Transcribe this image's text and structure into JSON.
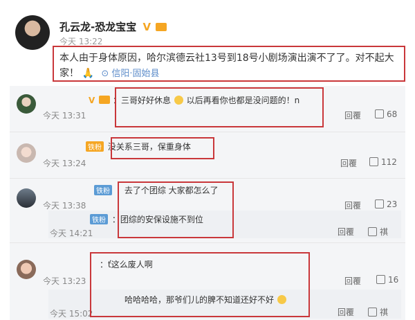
{
  "post": {
    "author": "孔云龙-恐龙宝宝",
    "verified": "V",
    "time": "今天 13:22",
    "text": "本人由于身体原因，哈尔滨德云社13号到18号小剧场演出演不了了。对不起大家！",
    "pray_emoji": "🙏",
    "location": "信阳·固始县"
  },
  "comments": [
    {
      "badge": "V",
      "text": "：三哥好好休息",
      "text_after": "以后再看你也都是没问题的！n",
      "time": "今天 13:31",
      "reply": "回覆",
      "likes": "68"
    },
    {
      "badge": "铁粉",
      "text": "没关系三哥，保重身体",
      "time": "今天 13:24",
      "reply": "回覆",
      "likes": "112"
    },
    {
      "badge": "铁粉",
      "text": "：去了个团综 大家都怎么了",
      "time": "今天 13:38",
      "reply": "回覆",
      "likes": "23",
      "sub": {
        "badge": "铁粉",
        "text": "：团综的安保设施不到位",
        "time": "今天 14:21",
        "reply": "回覆",
        "extra": "祺"
      }
    },
    {
      "text": "：ť这么废人啊",
      "time": "今天 13:23",
      "reply": "回覆",
      "likes": "16",
      "sub": {
        "text": "哈哈哈哈，那爷们儿的脾不知道还好不好",
        "time": "今天 15:02",
        "reply": "回覆",
        "extra": "祺"
      }
    }
  ],
  "colors": {
    "highlight_box": "#c9373a",
    "link": "#5b8bc9",
    "vip": "#f5a623",
    "fan_tag": "#5b9bd5"
  }
}
